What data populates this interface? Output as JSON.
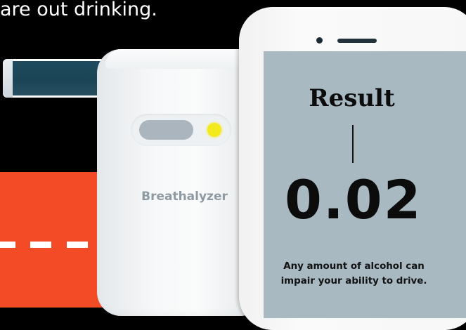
{
  "caption": "are out drinking.",
  "device": {
    "label": "Breathalyzer",
    "led_icon": "yellow-led-indicator"
  },
  "phone": {
    "result_title": "Result",
    "value": "0.02",
    "note_line1": "Any amount of alcohol can",
    "note_line2": "impair your ability to drive."
  },
  "colors": {
    "background": "#000000",
    "orange": "#f24b25",
    "screen": "#a9b9c1",
    "tube": "#1d4b5d",
    "led": "#f3ea1e"
  }
}
